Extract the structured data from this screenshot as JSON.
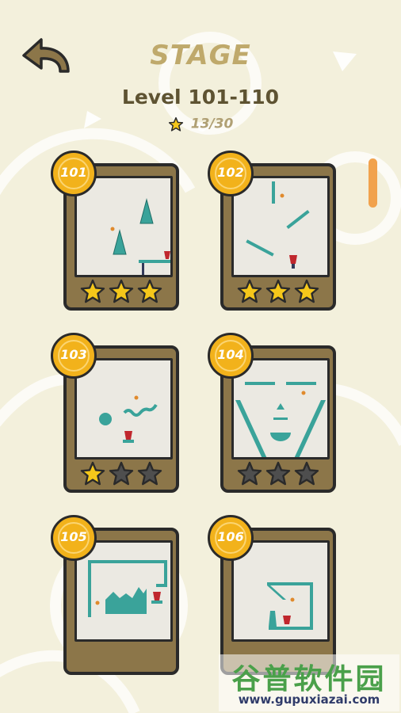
{
  "header": {
    "title": "STAGE",
    "subtitle": "Level 101-110",
    "star_count": "13/30"
  },
  "colors": {
    "background": "#f3f0dc",
    "card_frame": "#8c7649",
    "badge": "#f2b21b",
    "star_earned": "#f5c71a",
    "star_empty": "#4e4e4e",
    "teal_shape": "#3aa39a",
    "cup_red": "#c0272d",
    "scroll_thumb": "#f1a24d"
  },
  "levels": [
    {
      "number": "101",
      "stars_earned": 3,
      "stars_total": 3
    },
    {
      "number": "102",
      "stars_earned": 3,
      "stars_total": 3
    },
    {
      "number": "103",
      "stars_earned": 1,
      "stars_total": 3
    },
    {
      "number": "104",
      "stars_earned": 0,
      "stars_total": 3
    },
    {
      "number": "105"
    },
    {
      "number": "106"
    }
  ],
  "watermark": {
    "title": "谷普软件园",
    "url": "www.gupuxiazai.com"
  }
}
